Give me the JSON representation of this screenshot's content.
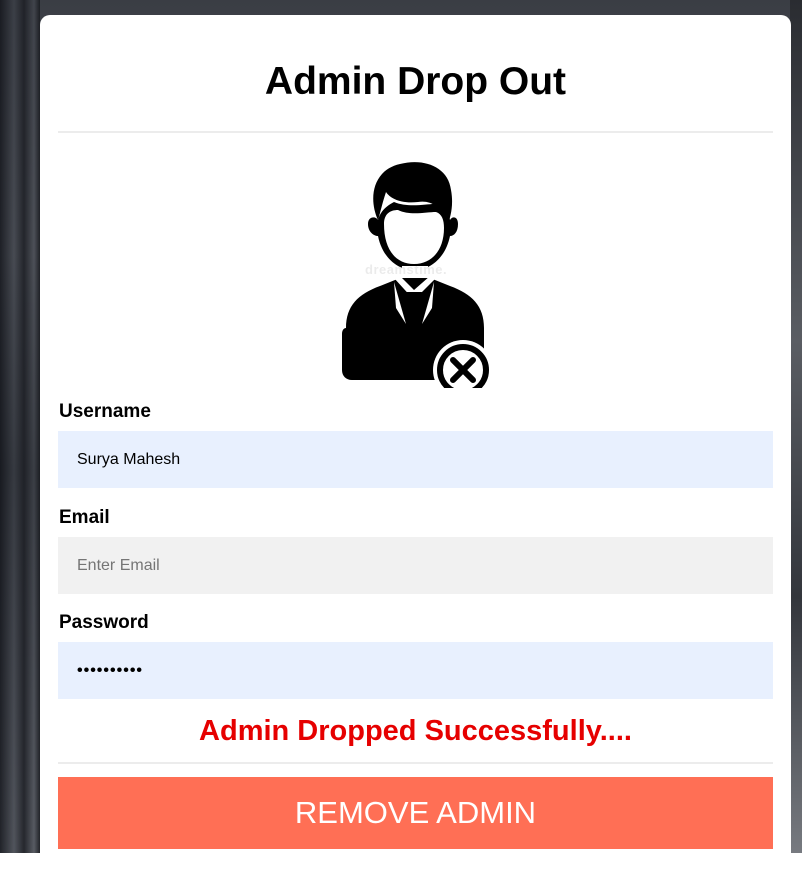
{
  "page": {
    "title": "Admin Drop Out"
  },
  "avatar": {
    "icon": "admin-remove-icon",
    "watermark": "dreamstime."
  },
  "form": {
    "username": {
      "label": "Username",
      "value": "Surya Mahesh"
    },
    "email": {
      "label": "Email",
      "placeholder": "Enter Email",
      "value": ""
    },
    "password": {
      "label": "Password",
      "value_masked": "••••••••••"
    }
  },
  "status": {
    "message": "Admin Dropped Successfully....",
    "color": "#e60000"
  },
  "actions": {
    "remove_label": "REMOVE ADMIN",
    "remove_color": "#ff6f55"
  }
}
